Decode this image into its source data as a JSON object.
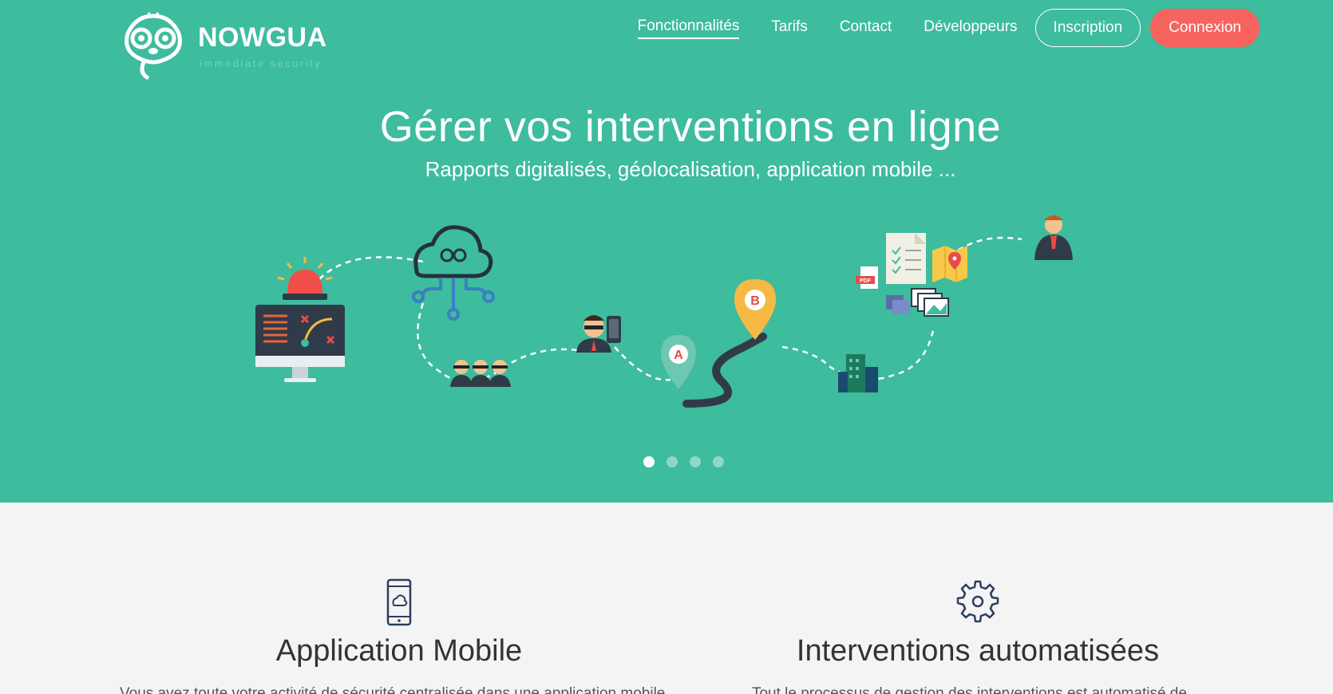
{
  "brand": {
    "name": "NOWGUA",
    "tagline": "immediate security"
  },
  "nav": {
    "links": [
      "Fonctionnalités",
      "Tarifs",
      "Contact",
      "Développeurs"
    ],
    "signup": "Inscription",
    "login": "Connexion"
  },
  "hero": {
    "title": "Gérer vos interventions en ligne",
    "subtitle": "Rapports digitalisés, géolocalisation, application mobile ...",
    "marker_a": "A",
    "marker_b": "B",
    "pdf": "PDF",
    "carousel": {
      "count": 4,
      "active": 1
    }
  },
  "features": [
    {
      "title": "Application Mobile",
      "text": "Vous avez toute votre activité de sécurité centralisée dans une application mobile ..."
    },
    {
      "title": "Interventions automatisées",
      "text": "Tout le processus de gestion des interventions est automatisé de ..."
    }
  ],
  "colors": {
    "hero": "#3dbc9e",
    "accent": "#f7635f",
    "body": "#f4f4f4",
    "icon": "#2a3f5f"
  }
}
